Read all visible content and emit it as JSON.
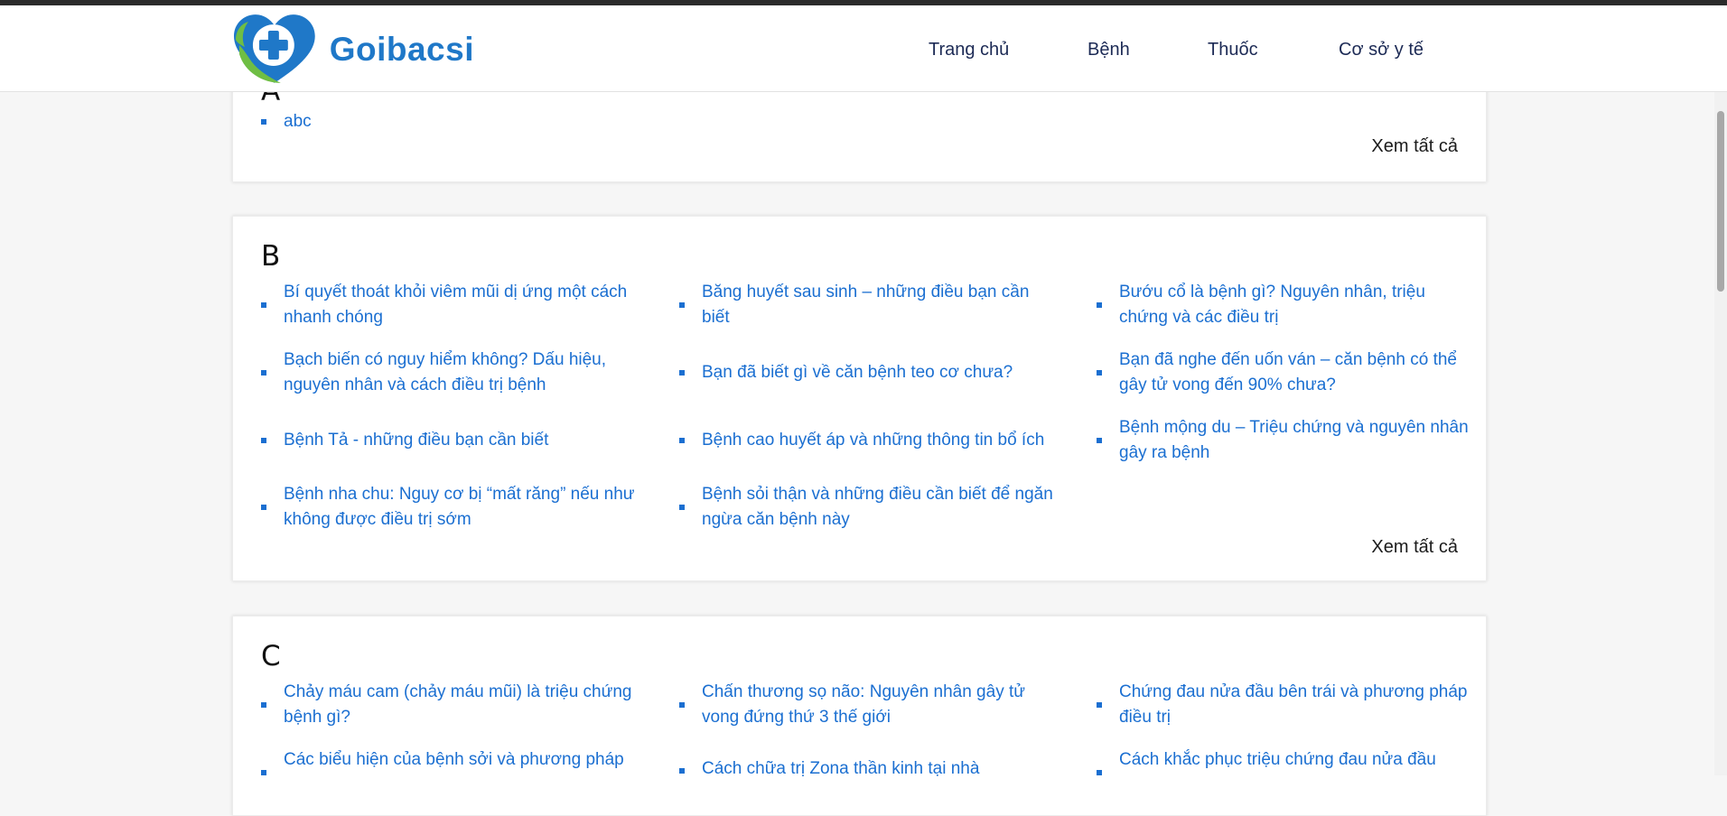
{
  "header": {
    "logo_text": "Goibacsi",
    "nav": [
      "Trang chủ",
      "Bệnh",
      "Thuốc",
      "Cơ sở y tế"
    ]
  },
  "sections": [
    {
      "letter": "A",
      "items": [
        "abc"
      ],
      "view_all": "Xem tất cả"
    },
    {
      "letter": "B",
      "items": [
        "Bí quyết thoát khỏi viêm mũi dị ứng một cách nhanh chóng",
        "Băng huyết sau sinh – những điều bạn cần biết",
        "Bướu cổ là bệnh gì? Nguyên nhân, triệu chứng và các điều trị",
        "Bạch biến có nguy hiểm không? Dấu hiệu, nguyên nhân và cách điều trị bệnh",
        "Bạn đã biết gì về căn bệnh teo cơ chưa?",
        "Bạn đã nghe đến uốn ván – căn bệnh có thể gây tử vong đến 90% chưa?",
        "Bệnh Tả - những điều bạn cần biết",
        "Bệnh cao huyết áp và những thông tin bổ ích",
        "Bệnh mộng du – Triệu chứng và nguyên nhân gây ra bệnh",
        "Bệnh nha chu: Nguy cơ bị “mất răng” nếu như không được điều trị sớm",
        "Bệnh sỏi thận và những điều cần biết để ngăn ngừa căn bệnh này"
      ],
      "view_all": "Xem tất cả"
    },
    {
      "letter": "C",
      "items": [
        "Chảy máu cam (chảy máu mũi) là triệu chứng bệnh gì?",
        "Chấn thương sọ não: Nguyên nhân gây tử vong đứng thứ 3 thế giới",
        "Chứng đau nửa đầu bên trái và phương pháp điều trị",
        "Các biểu hiện của bệnh sởi và phương pháp",
        "Cách chữa trị Zona thần kinh tại nhà",
        "Cách khắc phục triệu chứng đau nửa đầu"
      ]
    }
  ],
  "colors": {
    "link": "#1b6fd1",
    "brand": "#1f78c8",
    "logo_green": "#6fbe44",
    "nav": "#1c2a55"
  }
}
